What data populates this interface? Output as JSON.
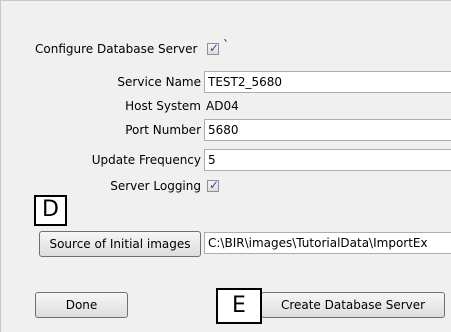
{
  "form": {
    "configure_label": "Configure Database Server",
    "configure_checked": true,
    "configure_extra": "`",
    "service_name_label": "Service Name",
    "service_name_value": "TEST2_5680",
    "host_system_label": "Host System",
    "host_system_value": "AD04",
    "port_number_label": "Port Number",
    "port_number_value": "5680",
    "update_frequency_label": "Update Frequency",
    "update_frequency_value": "5",
    "server_logging_label": "Server Logging",
    "server_logging_checked": true,
    "source_button_label": "Source of Initial images",
    "source_path_value": "C:\\BIR\\images\\TutorialData\\ImportEx"
  },
  "buttons": {
    "done_label": "Done",
    "create_label": "Create Database Server"
  },
  "callouts": {
    "d": "D",
    "e": "E"
  },
  "icons": {
    "checkmark": "checkmark-icon"
  }
}
